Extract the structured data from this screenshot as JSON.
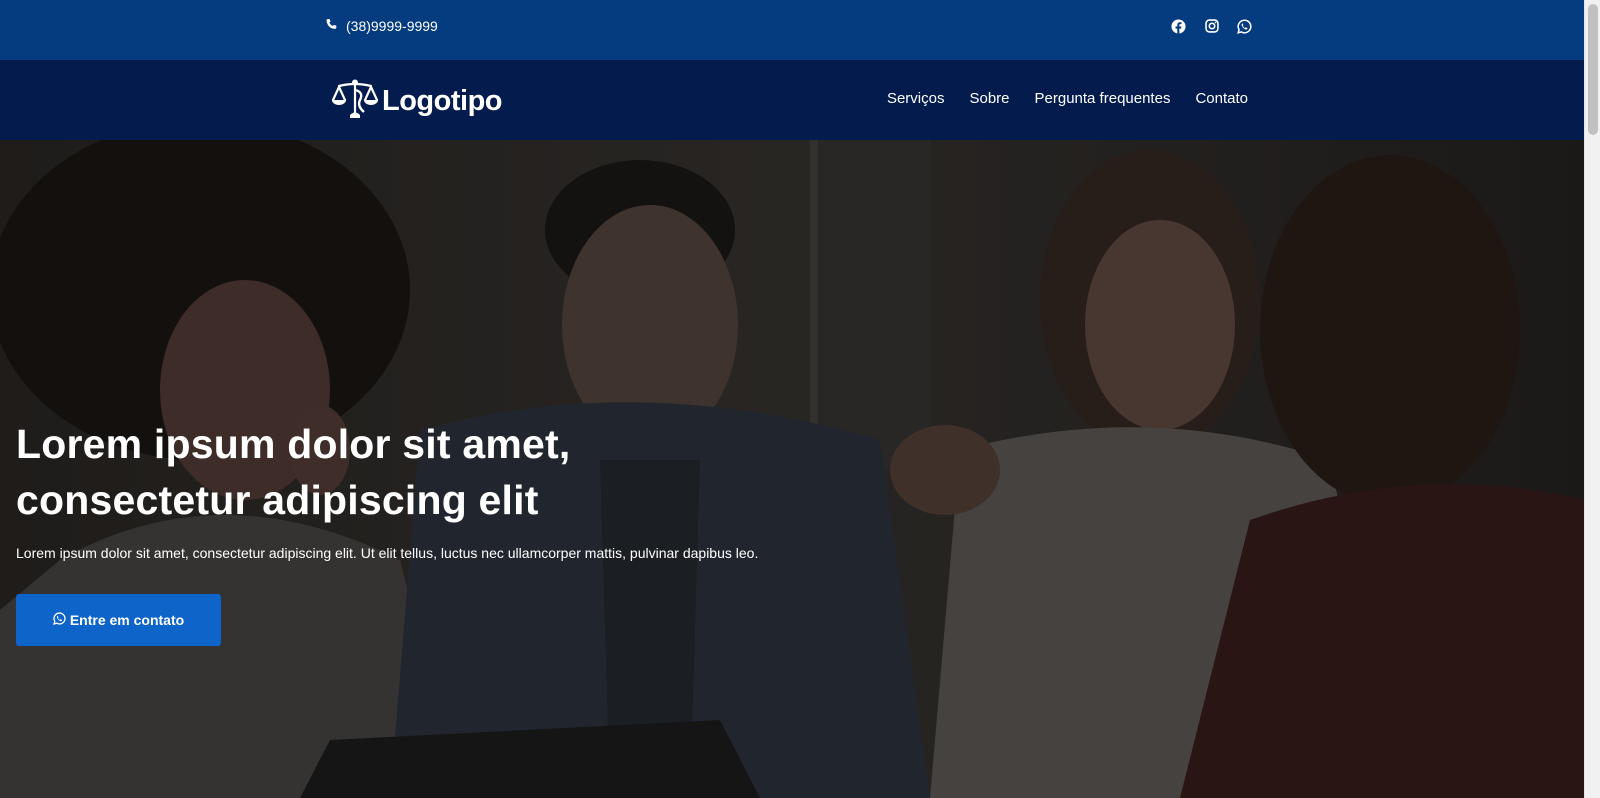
{
  "topbar": {
    "phone": "(38)9999-9999",
    "phone_icon": "phone-icon",
    "socials": [
      {
        "name": "Facebook",
        "icon": "facebook-icon"
      },
      {
        "name": "Instagram",
        "icon": "instagram-icon"
      },
      {
        "name": "WhatsApp",
        "icon": "whatsapp-icon"
      }
    ]
  },
  "header": {
    "logo_text": "Logotipo",
    "logo_icon": "scales-of-justice-icon",
    "nav": [
      {
        "label": "Serviços"
      },
      {
        "label": "Sobre"
      },
      {
        "label": "Pergunta frequentes"
      },
      {
        "label": "Contato"
      }
    ]
  },
  "hero": {
    "title_line1": "Lorem ipsum dolor sit amet,",
    "title_line2": "consectetur adipiscing elit",
    "text": "Lorem ipsum dolor sit amet, consectetur adipiscing elit. Ut elit tellus, luctus nec ullamcorper mattis, pulvinar dapibus leo.",
    "cta_label": "Entre em contato",
    "cta_icon": "whatsapp-icon"
  },
  "colors": {
    "topbar_bg": "#053b7f",
    "navbar_bg": "#041b4e",
    "cta_bg": "#0e64c8",
    "text": "#ffffff"
  }
}
